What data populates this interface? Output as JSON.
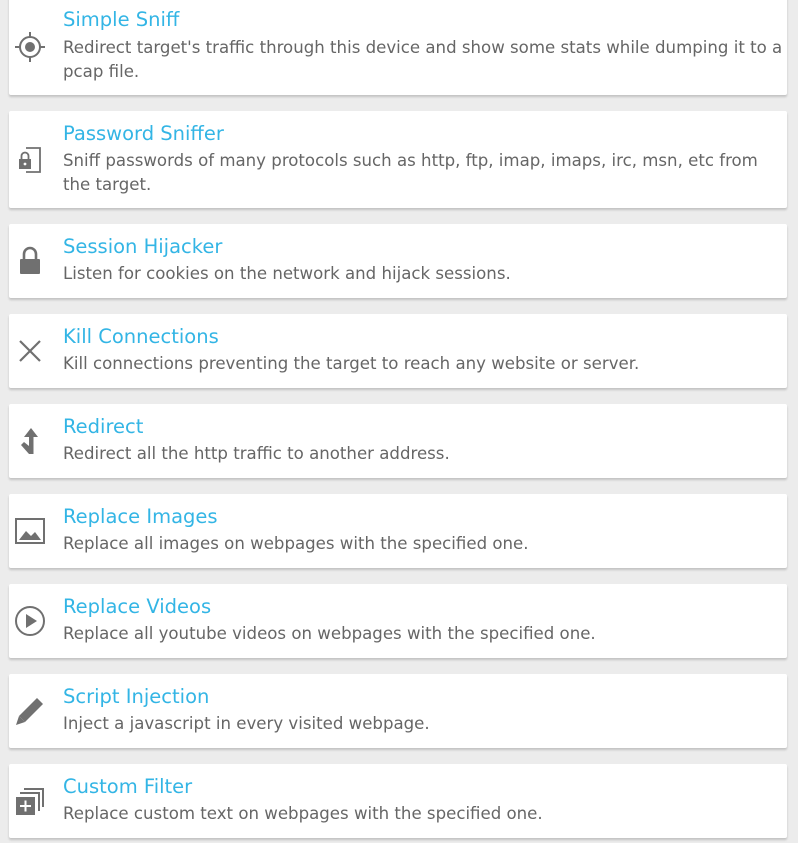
{
  "colors": {
    "title": "#33b5e5",
    "description": "#666666",
    "icon": "#707070",
    "card": "#ffffff",
    "background": "#ececec"
  },
  "items": [
    {
      "icon": "gps-target-icon",
      "title": "Simple Sniff",
      "description": "Redirect target's traffic through this device and show some stats while dumping it to a pcap file."
    },
    {
      "icon": "password-lock-icon",
      "title": "Password Sniffer",
      "description": "Sniff passwords of many protocols such as http, ftp, imap, imaps, irc, msn, etc from the target."
    },
    {
      "icon": "lock-icon",
      "title": "Session Hijacker",
      "description": "Listen for cookies on the network and hijack sessions."
    },
    {
      "icon": "close-icon",
      "title": "Kill Connections",
      "description": "Kill connections preventing the target to reach any website or server."
    },
    {
      "icon": "redirect-arrow-icon",
      "title": "Redirect",
      "description": "Redirect all the http traffic to another address."
    },
    {
      "icon": "image-icon",
      "title": "Replace Images",
      "description": "Replace all images on webpages with the specified one."
    },
    {
      "icon": "play-icon",
      "title": "Replace Videos",
      "description": "Replace all youtube videos on webpages with the specified one."
    },
    {
      "icon": "pencil-icon",
      "title": "Script Injection",
      "description": "Inject a javascript in every visited webpage."
    },
    {
      "icon": "add-to-stack-icon",
      "title": "Custom Filter",
      "description": "Replace custom text on webpages with the specified one."
    }
  ]
}
